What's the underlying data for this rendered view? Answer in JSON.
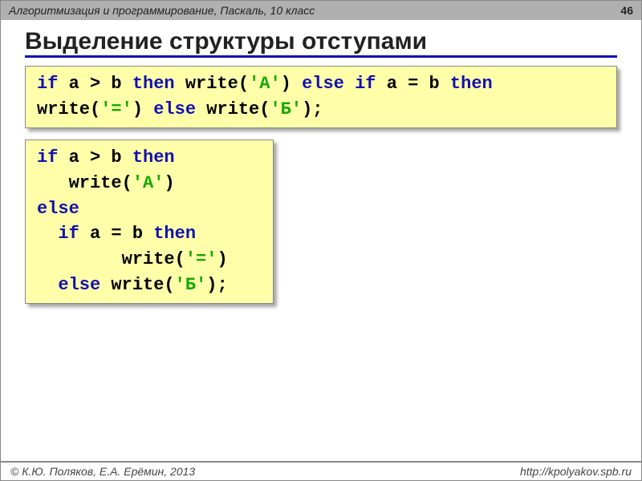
{
  "header": {
    "course": "Алгоритмизация и программирование, Паскаль, 10 класс",
    "page": "46"
  },
  "title": "Выделение структуры отступами",
  "code1": {
    "tokens": [
      {
        "t": "if",
        "c": "kw"
      },
      {
        "t": " a > b ",
        "c": "fn"
      },
      {
        "t": "then",
        "c": "kw"
      },
      {
        "t": " write(",
        "c": "fn"
      },
      {
        "t": "'A'",
        "c": "lit"
      },
      {
        "t": ") ",
        "c": "fn"
      },
      {
        "t": "else",
        "c": "kw"
      },
      {
        "t": " ",
        "c": "fn"
      },
      {
        "t": "if",
        "c": "kw"
      },
      {
        "t": " a = b ",
        "c": "fn"
      },
      {
        "t": "then",
        "c": "kw"
      },
      {
        "t": "\nwrite(",
        "c": "fn"
      },
      {
        "t": "'='",
        "c": "lit"
      },
      {
        "t": ") ",
        "c": "fn"
      },
      {
        "t": "else",
        "c": "kw"
      },
      {
        "t": " write(",
        "c": "fn"
      },
      {
        "t": "'Б'",
        "c": "lit"
      },
      {
        "t": ");",
        "c": "fn"
      }
    ]
  },
  "code2": {
    "tokens": [
      {
        "t": "if",
        "c": "kw"
      },
      {
        "t": " a > b ",
        "c": "fn"
      },
      {
        "t": "then",
        "c": "kw"
      },
      {
        "t": "\n   write(",
        "c": "fn"
      },
      {
        "t": "'A'",
        "c": "lit"
      },
      {
        "t": ")",
        "c": "fn"
      },
      {
        "t": "\n",
        "c": "fn"
      },
      {
        "t": "else",
        "c": "kw"
      },
      {
        "t": "\n  ",
        "c": "fn"
      },
      {
        "t": "if",
        "c": "kw"
      },
      {
        "t": " a = b ",
        "c": "fn"
      },
      {
        "t": "then",
        "c": "kw"
      },
      {
        "t": "\n        write(",
        "c": "fn"
      },
      {
        "t": "'='",
        "c": "lit"
      },
      {
        "t": ")",
        "c": "fn"
      },
      {
        "t": "\n  ",
        "c": "fn"
      },
      {
        "t": "else",
        "c": "kw"
      },
      {
        "t": " write(",
        "c": "fn"
      },
      {
        "t": "'Б'",
        "c": "lit"
      },
      {
        "t": ");",
        "c": "fn"
      }
    ]
  },
  "footer": {
    "copyright": "© К.Ю. Поляков, Е.А. Ерёмин, 2013",
    "url": "http://kpolyakov.spb.ru"
  }
}
